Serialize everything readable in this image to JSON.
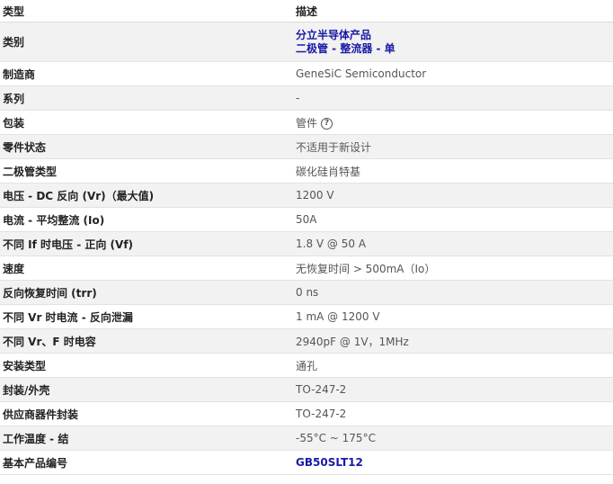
{
  "headers": {
    "type": "类型",
    "description": "描述"
  },
  "rows": {
    "category": {
      "label": "类别",
      "line1": "分立半导体产品",
      "line2": "二极管 - 整流器 - 单"
    },
    "manufacturer": {
      "label": "制造商",
      "value": "GeneSiC Semiconductor"
    },
    "series": {
      "label": "系列",
      "value": "-"
    },
    "package": {
      "label": "包装",
      "value": "管件",
      "icon": "help-circle-icon"
    },
    "part_status": {
      "label": "零件状态",
      "value": "不适用于新设计"
    },
    "diode_type": {
      "label": "二极管类型",
      "value": "碳化硅肖特基"
    },
    "voltage_dc_reverse": {
      "label": "电压 - DC 反向 (Vr)（最大值)",
      "value": "1200 V"
    },
    "current_avg_rectified": {
      "label": "电流 - 平均整流 (Io)",
      "value": "50A"
    },
    "voltage_forward": {
      "label": "不同 If 时电压 - 正向 (Vf)",
      "value": "1.8 V @ 50 A"
    },
    "speed": {
      "label": "速度",
      "value": "无恢复时间 > 500mA（Io）"
    },
    "reverse_recovery": {
      "label": "反向恢复时间 (trr)",
      "value": "0 ns"
    },
    "reverse_leakage": {
      "label": "不同 Vr 时电流 - 反向泄漏",
      "value": "1 mA @ 1200 V"
    },
    "capacitance": {
      "label": "不同 Vr、F 时电容",
      "value": "2940pF @ 1V，1MHz"
    },
    "mounting_type": {
      "label": "安装类型",
      "value": "通孔"
    },
    "package_case": {
      "label": "封装/外壳",
      "value": "TO-247-2"
    },
    "supplier_package": {
      "label": "供应商器件封装",
      "value": "TO-247-2"
    },
    "operating_temp": {
      "label": "工作温度 - 结",
      "value": "-55°C ~ 175°C"
    },
    "base_part_number": {
      "label": "基本产品编号",
      "value": "GB50SLT12"
    }
  }
}
